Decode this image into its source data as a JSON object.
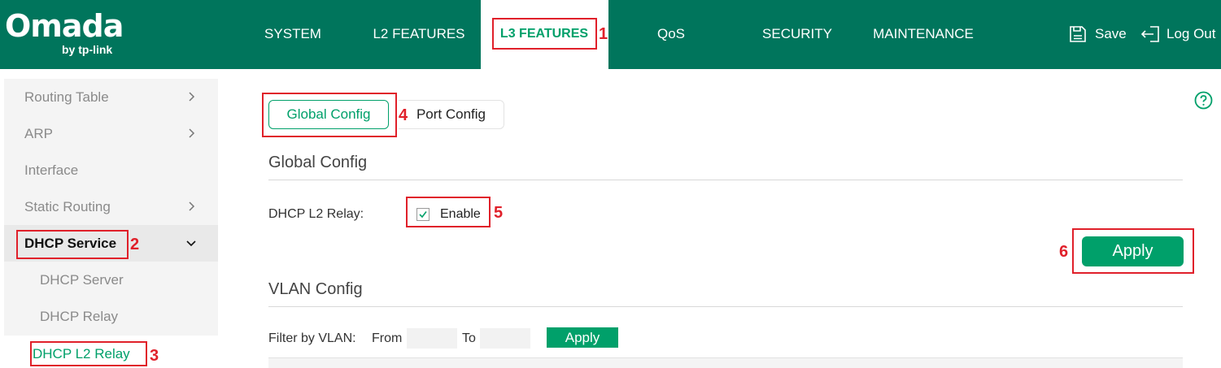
{
  "brand": {
    "name": "Omada",
    "sub": "by tp-link"
  },
  "nav": [
    {
      "label": "SYSTEM",
      "active": false
    },
    {
      "label": "L2 FEATURES",
      "active": false
    },
    {
      "label": "L3 FEATURES",
      "active": true
    },
    {
      "label": "QoS",
      "active": false
    },
    {
      "label": "SECURITY",
      "active": false
    },
    {
      "label": "MAINTENANCE",
      "active": false
    }
  ],
  "header_actions": {
    "save": "Save",
    "logout": "Log Out"
  },
  "sidebar": {
    "items": [
      {
        "label": "Routing Table",
        "chevron": "right"
      },
      {
        "label": "ARP",
        "chevron": "right"
      },
      {
        "label": "Interface",
        "chevron": ""
      },
      {
        "label": "Static Routing",
        "chevron": "right"
      },
      {
        "label": "DHCP Service",
        "chevron": "down"
      },
      {
        "label": "DHCP Server",
        "chevron": ""
      },
      {
        "label": "DHCP Relay",
        "chevron": ""
      },
      {
        "label": "DHCP L2 Relay",
        "chevron": ""
      }
    ]
  },
  "tabs": {
    "global": "Global Config",
    "port": "Port Config"
  },
  "global_config": {
    "title": "Global Config",
    "relay_label": "DHCP L2 Relay:",
    "enable_label": "Enable",
    "enabled": true,
    "apply": "Apply"
  },
  "vlan_config": {
    "title": "VLAN Config",
    "filter_label": "Filter by VLAN:",
    "from_label": "From",
    "from_value": "",
    "to_label": "To",
    "to_value": "",
    "apply": "Apply"
  },
  "annotations": [
    "1",
    "2",
    "3",
    "4",
    "5",
    "6"
  ],
  "colors": {
    "header": "#00755c",
    "accent": "#00a06a",
    "annotation": "#e0202a"
  }
}
